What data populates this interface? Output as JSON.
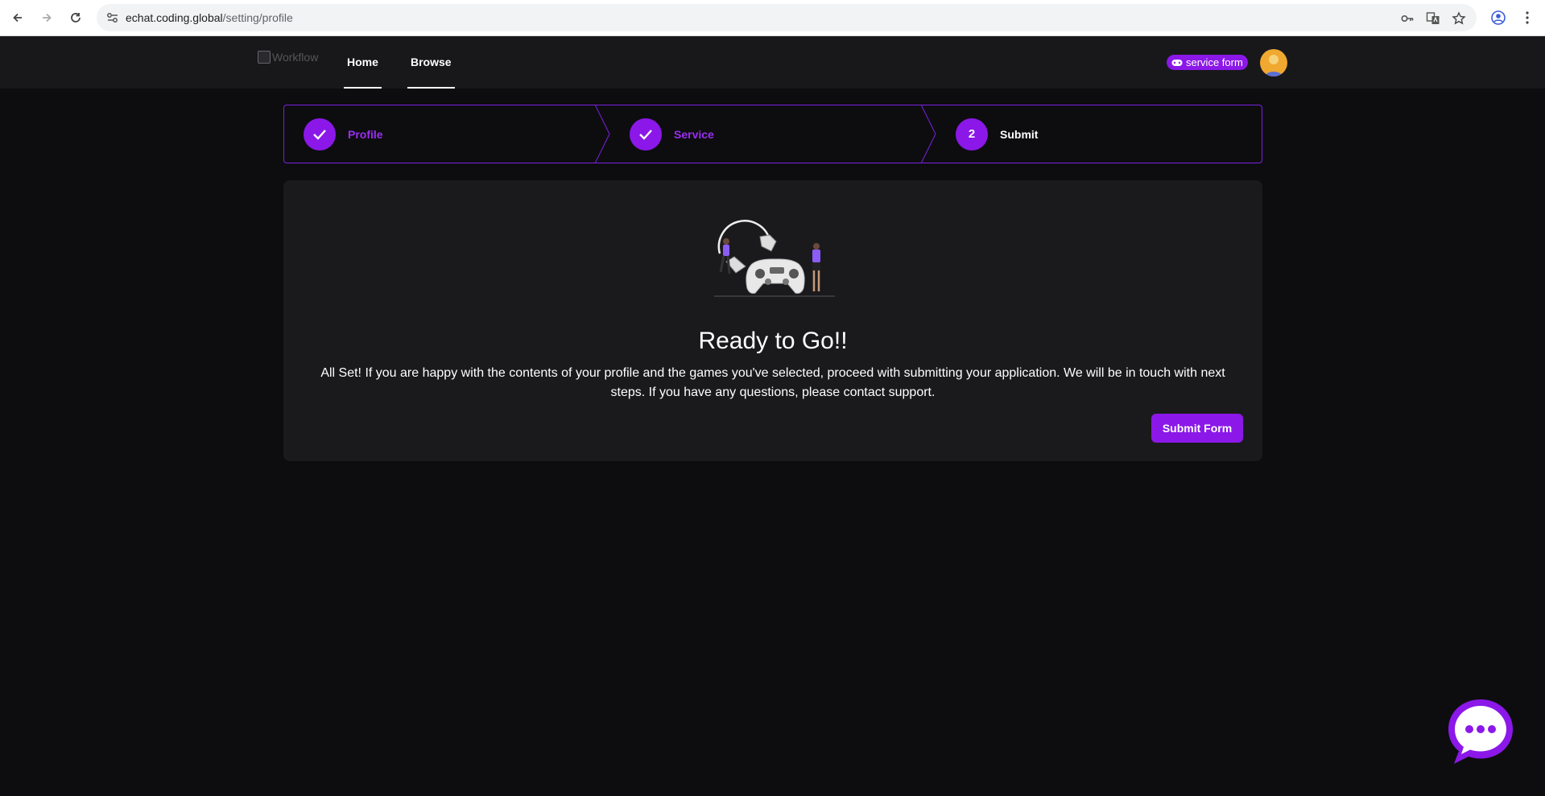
{
  "browser": {
    "url_host": "echat.coding.global",
    "url_path": "/setting/profile"
  },
  "header": {
    "logo_alt": "Workflow",
    "nav": [
      {
        "label": "Home"
      },
      {
        "label": "Browse"
      }
    ],
    "badge_label": "service form"
  },
  "stepper": {
    "steps": [
      {
        "label": "Profile",
        "status": "complete"
      },
      {
        "label": "Service",
        "status": "complete"
      },
      {
        "label": "Submit",
        "status": "current",
        "number": "2"
      }
    ]
  },
  "card": {
    "title": "Ready to Go!!",
    "message": "All Set! If you are happy with the contents of your profile and the games you've selected, proceed with submitting your application. We will be in touch with next steps. If you have any questions, please contact support.",
    "submit_label": "Submit Form"
  },
  "colors": {
    "accent": "#8b18e8",
    "background": "#0d0d10",
    "card": "#1a1a1d",
    "header": "#18181b"
  }
}
